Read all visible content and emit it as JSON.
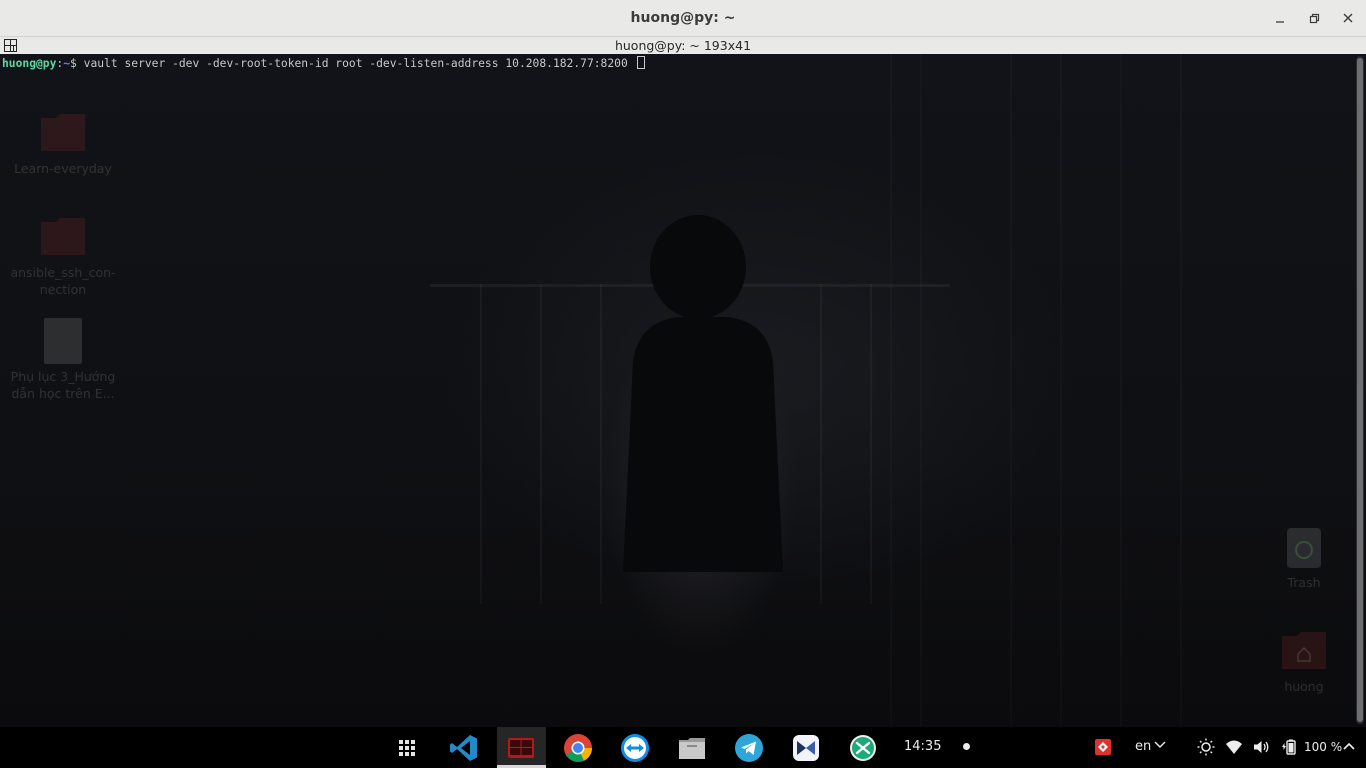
{
  "window": {
    "title": "huong@py: ~",
    "subtitle": "huong@py: ~ 193x41"
  },
  "terminal": {
    "prompt_user_host": "huong@py",
    "prompt_sep": ":",
    "prompt_path": "~",
    "prompt_symbol": "$ ",
    "command": "vault server -dev -dev-root-token-id root -dev-listen-address 10.208.182.77:8200 "
  },
  "desktop": {
    "items_left": [
      {
        "label": "Learn-everyday",
        "icon": "folder-icon"
      },
      {
        "label": "ansible_ssh_con-\nnection",
        "icon": "folder-icon"
      },
      {
        "label": "Phụ lục 3_Hướng\ndẫn học trên E...",
        "icon": "document-icon"
      }
    ],
    "items_right": [
      {
        "label": "Trash",
        "icon": "trash-icon"
      },
      {
        "label": "huong",
        "icon": "home-folder-icon"
      }
    ]
  },
  "taskbar": {
    "apps": [
      "app-grid-icon",
      "vscode-icon",
      "terminal-icon",
      "chrome-icon",
      "teamviewer-icon",
      "files-icon",
      "telegram-icon",
      "mattermost-icon",
      "xmind-icon"
    ],
    "active_app": "terminal-icon",
    "clock": "14:35",
    "language": "en",
    "battery": "100 %",
    "tray_icons": [
      "anydesk-icon",
      "brightness-icon",
      "wifi-icon",
      "volume-icon",
      "battery-icon",
      "power-icon"
    ]
  },
  "colors": {
    "prompt_user": "#5fd7a2",
    "prompt_path": "#5f87d7",
    "titlebar_bg": "#e9e9e7",
    "terminal_bg": "#111318",
    "taskbar_bg": "#000000"
  }
}
